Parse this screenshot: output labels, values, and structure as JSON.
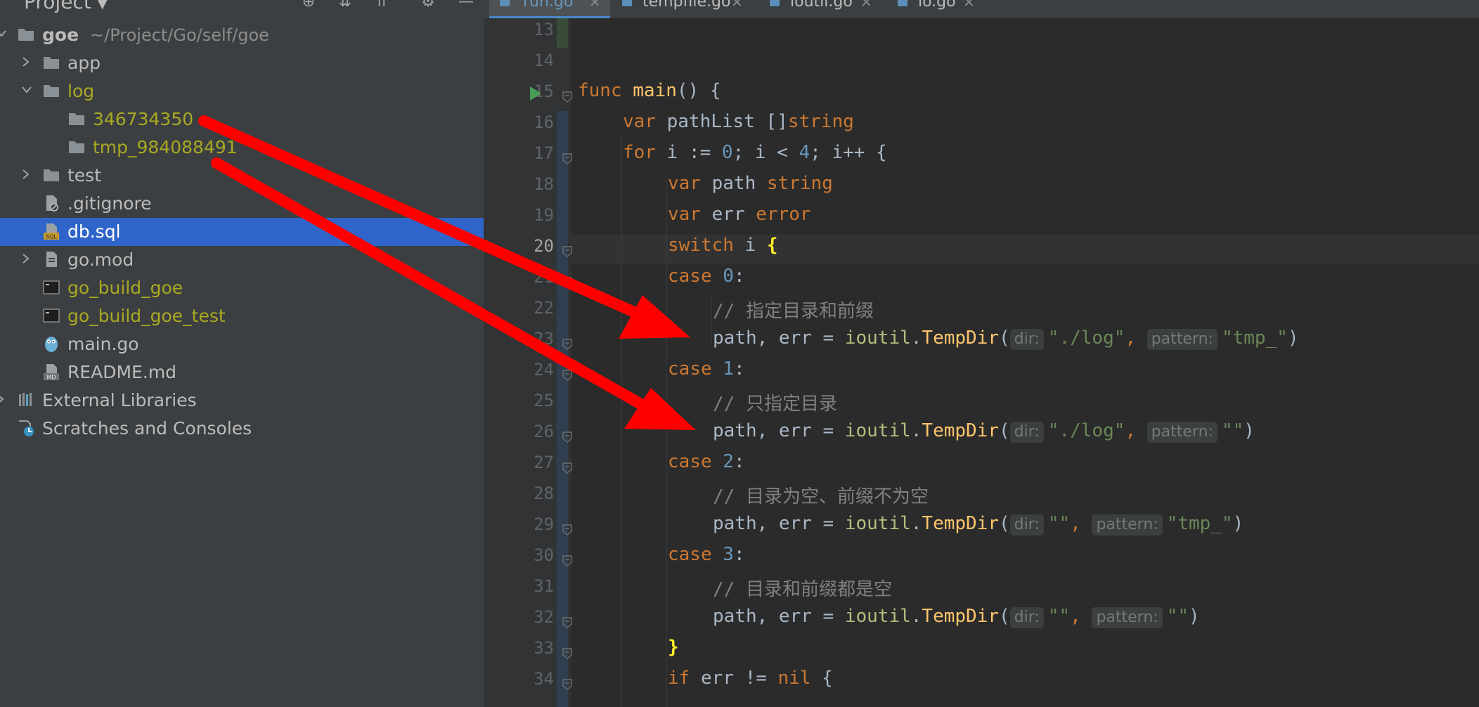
{
  "project_panel": {
    "title": "Project",
    "tree": [
      {
        "label": "goe",
        "sub": "~/Project/Go/self/goe",
        "depth": 0,
        "arrow": "open",
        "icon": "folder-icon",
        "style": "bold"
      },
      {
        "label": "app",
        "depth": 1,
        "arrow": "closed",
        "icon": "folder-icon"
      },
      {
        "label": "log",
        "depth": 1,
        "arrow": "open",
        "icon": "folder-icon",
        "style": "olive"
      },
      {
        "label": "346734350",
        "depth": 2,
        "icon": "folder-icon",
        "style": "olive"
      },
      {
        "label": "tmp_984088491",
        "depth": 2,
        "icon": "folder-icon",
        "style": "olive"
      },
      {
        "label": "test",
        "depth": 1,
        "arrow": "closed",
        "icon": "folder-icon"
      },
      {
        "label": ".gitignore",
        "depth": 1,
        "icon": "ignore-file-icon"
      },
      {
        "label": "db.sql",
        "depth": 1,
        "icon": "sql-file-icon",
        "selected": true
      },
      {
        "label": "go.mod",
        "depth": 1,
        "arrow": "closed",
        "icon": "file-icon"
      },
      {
        "label": "go_build_goe",
        "depth": 1,
        "icon": "executable-icon",
        "style": "olive"
      },
      {
        "label": "go_build_goe_test",
        "depth": 1,
        "icon": "executable-icon",
        "style": "olive"
      },
      {
        "label": "main.go",
        "depth": 1,
        "icon": "go-file-icon"
      },
      {
        "label": "README.md",
        "depth": 1,
        "icon": "markdown-file-icon"
      },
      {
        "label": "External Libraries",
        "depth": 0,
        "arrow": "closed",
        "icon": "library-icon"
      },
      {
        "label": "Scratches and Consoles",
        "depth": 0,
        "icon": "scratches-icon"
      }
    ]
  },
  "tabs": [
    {
      "label": "run.go",
      "active": true
    },
    {
      "label": "tempfile.go"
    },
    {
      "label": "ioutil.go"
    },
    {
      "label": "io.go"
    }
  ],
  "editor": {
    "current_line": 20,
    "lines": [
      {
        "n": "13"
      },
      {
        "n": "14"
      },
      {
        "n": "15"
      },
      {
        "n": "16"
      },
      {
        "n": "17"
      },
      {
        "n": "18"
      },
      {
        "n": "19"
      },
      {
        "n": "20"
      },
      {
        "n": "21"
      },
      {
        "n": "22"
      },
      {
        "n": "23"
      },
      {
        "n": "24"
      },
      {
        "n": "25"
      },
      {
        "n": "26"
      },
      {
        "n": "27"
      },
      {
        "n": "28"
      },
      {
        "n": "29"
      },
      {
        "n": "30"
      },
      {
        "n": "31"
      },
      {
        "n": "32"
      },
      {
        "n": "33"
      },
      {
        "n": "34"
      }
    ],
    "code": {
      "l15": {
        "kw": "func",
        "fn": "main",
        "rest": "() {"
      },
      "l16": {
        "kw": "var",
        "ident": "pathList",
        "punct": "[]",
        "type": "string"
      },
      "l17": {
        "kw": "for",
        "a": "i := ",
        "n0": "0",
        "b": "; i < ",
        "n4": "4",
        "c": "; i++ {"
      },
      "l18": {
        "kw": "var",
        "ident": "path",
        "type": "string"
      },
      "l19": {
        "kw": "var",
        "ident": "err",
        "type": "error"
      },
      "l20": {
        "kw": "switch",
        "ident": "i",
        "brace": "{"
      },
      "l21": {
        "kw": "case",
        "num": "0",
        "colon": ":"
      },
      "l22": {
        "comment": "// 指定目录和前缀"
      },
      "l23": {
        "lhs": "path, err = ",
        "pkg": "ioutil",
        "dot": ".",
        "fn": "TempDir",
        "open": "(",
        "hint_dir": "dir:",
        "arg1": "\"./log\"",
        "comma": ", ",
        "hint_pattern": "pattern:",
        "arg2": "\"tmp_\"",
        "close": ")"
      },
      "l24": {
        "kw": "case",
        "num": "1",
        "colon": ":"
      },
      "l25": {
        "comment": "// 只指定目录"
      },
      "l26": {
        "lhs": "path, err = ",
        "pkg": "ioutil",
        "dot": ".",
        "fn": "TempDir",
        "open": "(",
        "hint_dir": "dir:",
        "arg1": "\"./log\"",
        "comma": ", ",
        "hint_pattern": "pattern:",
        "arg2": "\"\"",
        "close": ")"
      },
      "l27": {
        "kw": "case",
        "num": "2",
        "colon": ":"
      },
      "l28": {
        "comment": "// 目录为空、前缀不为空"
      },
      "l29": {
        "lhs": "path, err = ",
        "pkg": "ioutil",
        "dot": ".",
        "fn": "TempDir",
        "open": "(",
        "hint_dir": "dir:",
        "arg1": "\"\"",
        "comma": ", ",
        "hint_pattern": "pattern:",
        "arg2": "\"tmp_\"",
        "close": ")"
      },
      "l30": {
        "kw": "case",
        "num": "3",
        "colon": ":"
      },
      "l31": {
        "comment": "// 目录和前缀都是空"
      },
      "l32": {
        "lhs": "path, err = ",
        "pkg": "ioutil",
        "dot": ".",
        "fn": "TempDir",
        "open": "(",
        "hint_dir": "dir:",
        "arg1": "\"\"",
        "comma": ", ",
        "hint_pattern": "pattern:",
        "arg2": "\"\"",
        "close": ")"
      },
      "l33": {
        "brace": "}"
      },
      "l34": {
        "kw": "if",
        "rest": " err != ",
        "nil": "nil",
        "end": " {"
      }
    }
  },
  "colors": {
    "panel_bg": "#3c3f41",
    "editor_bg": "#2b2b2b",
    "selection": "#2f65ca",
    "annotation_arrow": "#ff0000",
    "keyword": "#cc7832",
    "string": "#6a8759"
  }
}
